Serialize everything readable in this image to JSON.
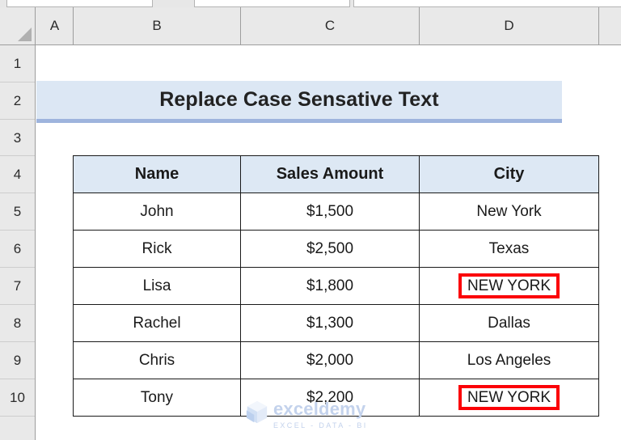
{
  "app": {
    "type": "spreadsheet",
    "ribbon_boxes": [
      "name-box",
      "formula-bar-left",
      "formula-bar-right"
    ]
  },
  "grid": {
    "select_all_icon": "select-all-triangle-icon",
    "column_headers": [
      "A",
      "B",
      "C",
      "D"
    ],
    "row_headers": [
      "1",
      "2",
      "3",
      "4",
      "5",
      "6",
      "7",
      "8",
      "9",
      "10"
    ]
  },
  "title": {
    "text": "Replace Case Sensative Text",
    "fill_color": "#dce7f4",
    "underline_color": "#9eb4dd"
  },
  "table": {
    "header_fill": "#dde8f4",
    "highlight_color": "#fb0007",
    "columns": [
      "Name",
      "Sales Amount",
      "City"
    ],
    "rows": [
      {
        "name": "John",
        "amount": "$1,500",
        "city": "New York",
        "highlight": false
      },
      {
        "name": "Rick",
        "amount": "$2,500",
        "city": "Texas",
        "highlight": false
      },
      {
        "name": "Lisa",
        "amount": "$1,800",
        "city": "NEW YORK",
        "highlight": true
      },
      {
        "name": "Rachel",
        "amount": "$1,300",
        "city": "Dallas",
        "highlight": false
      },
      {
        "name": "Chris",
        "amount": "$2,000",
        "city": "Los Angeles",
        "highlight": false
      },
      {
        "name": "Tony",
        "amount": "$2,200",
        "city": "NEW YORK",
        "highlight": true
      }
    ]
  },
  "watermark": {
    "name": "exceldemy",
    "tagline": "EXCEL - DATA - BI",
    "color": "#c3d2ec"
  }
}
